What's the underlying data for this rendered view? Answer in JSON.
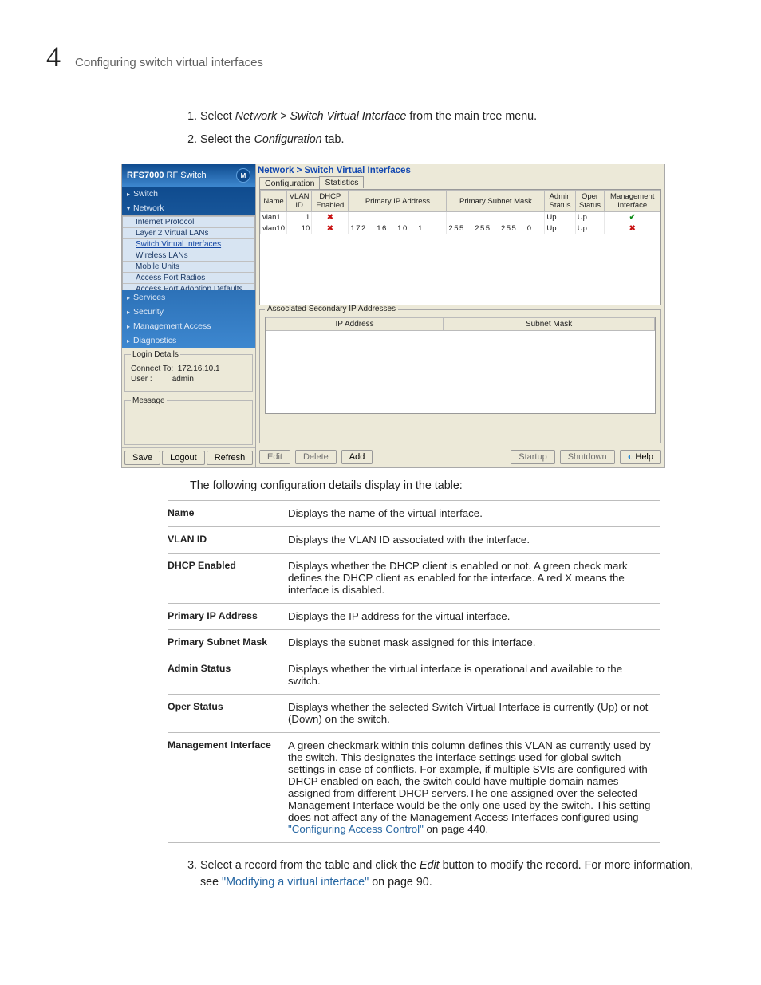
{
  "header": {
    "chapter_number": "4",
    "chapter_title": "Configuring switch virtual interfaces"
  },
  "steps_a": [
    {
      "lead": "Select ",
      "emA": "Network > Switch Virtual Interface",
      "tail": " from the main tree menu."
    },
    {
      "lead": "Select the ",
      "emA": "Configuration",
      "tail": " tab."
    }
  ],
  "screenshot": {
    "brand": "RFS7000",
    "brand_suffix": " RF Switch",
    "logoLetter": "M",
    "tree_top": [
      {
        "label": "Switch",
        "class": "tri"
      },
      {
        "label": "Network",
        "class": "trid"
      }
    ],
    "tree_sub": [
      "Internet Protocol",
      "Layer 2 Virtual LANs",
      "Switch Virtual Interfaces",
      "Wireless LANs",
      "Mobile Units",
      "Access Port Radios",
      "Access Port Adoption Defaults"
    ],
    "tree_bottom": [
      {
        "label": "Services",
        "class": "tri"
      },
      {
        "label": "Security",
        "class": "tri"
      },
      {
        "label": "Management Access",
        "class": "tri"
      },
      {
        "label": "Diagnostics",
        "class": "tri"
      }
    ],
    "login": {
      "title": "Login Details",
      "connect_label": "Connect To:",
      "connect_value": "172.16.10.1",
      "user_label": "User :",
      "user_value": "admin",
      "msg_label": "Message"
    },
    "bottom_buttons": [
      "Save",
      "Logout",
      "Refresh"
    ],
    "breadcrumb": "Network > Switch Virtual Interfaces",
    "tabs": [
      "Configuration",
      "Statistics"
    ],
    "grid_headers": [
      "Name",
      "VLAN ID",
      "DHCP Enabled",
      "Primary IP Address",
      "Primary Subnet Mask",
      "Admin Status",
      "Oper Status",
      "Management Interface"
    ],
    "grid_rows": [
      {
        "name": "vlan1",
        "vlan": "1",
        "dhcp": "x",
        "ip": "   .    .    .   ",
        "mask": "   .    .    .   ",
        "admin": "Up",
        "oper": "Up",
        "mgmt": "chk"
      },
      {
        "name": "vlan10",
        "vlan": "10",
        "dhcp": "x",
        "ip": " 172 .  16  .  10  .   1",
        "mask": " 255 . 255 . 255 .   0",
        "admin": "Up",
        "oper": "Up",
        "mgmt": "x"
      }
    ],
    "assoc_group_label": "Associated Secondary IP Addresses",
    "assoc_headers": [
      "IP Address",
      "Subnet Mask"
    ],
    "action_buttons_left": [
      "Edit",
      "Delete",
      "Add"
    ],
    "action_buttons_right": [
      "Startup",
      "Shutdown",
      "Help"
    ]
  },
  "intro_line": "The following configuration details display in the table:",
  "field_table": [
    {
      "label": "Name",
      "desc": "Displays the name of the virtual interface."
    },
    {
      "label": "VLAN ID",
      "desc": "Displays the VLAN ID associated with the interface."
    },
    {
      "label": "DHCP Enabled",
      "desc": "Displays whether the DHCP client is enabled or not. A green check mark defines the DHCP client as enabled for the interface. A red X means the interface is disabled."
    },
    {
      "label": "Primary IP Address",
      "desc": "Displays the IP address for the virtual interface."
    },
    {
      "label": "Primary Subnet Mask",
      "desc": "Displays the subnet mask assigned for this interface."
    },
    {
      "label": "Admin Status",
      "desc": "Displays whether the virtual interface is operational and available to the switch."
    },
    {
      "label": "Oper Status",
      "desc": "Displays whether the selected Switch Virtual Interface is currently (Up) or not (Down) on the switch."
    },
    {
      "label": "Management Interface",
      "desc_pre": "A green checkmark within this column defines this VLAN as currently used by the switch. This designates the interface settings used for global switch settings in case of conflicts. For example, if multiple SVIs are configured with DHCP enabled on each, the switch could have multiple domain names assigned from different DHCP servers.The one assigned over the selected Management Interface would be the only one used by the switch. This setting does not affect any of the Management Access Interfaces configured using ",
      "link": "\"Configuring Access Control\"",
      "desc_post": " on page 440."
    }
  ],
  "steps_b_item": {
    "lead": "Select a record from the table and click the ",
    "em": "Edit",
    "mid": " button to modify the record. For more information, see ",
    "link": "\"Modifying a virtual interface\"",
    "tail": " on page 90."
  }
}
